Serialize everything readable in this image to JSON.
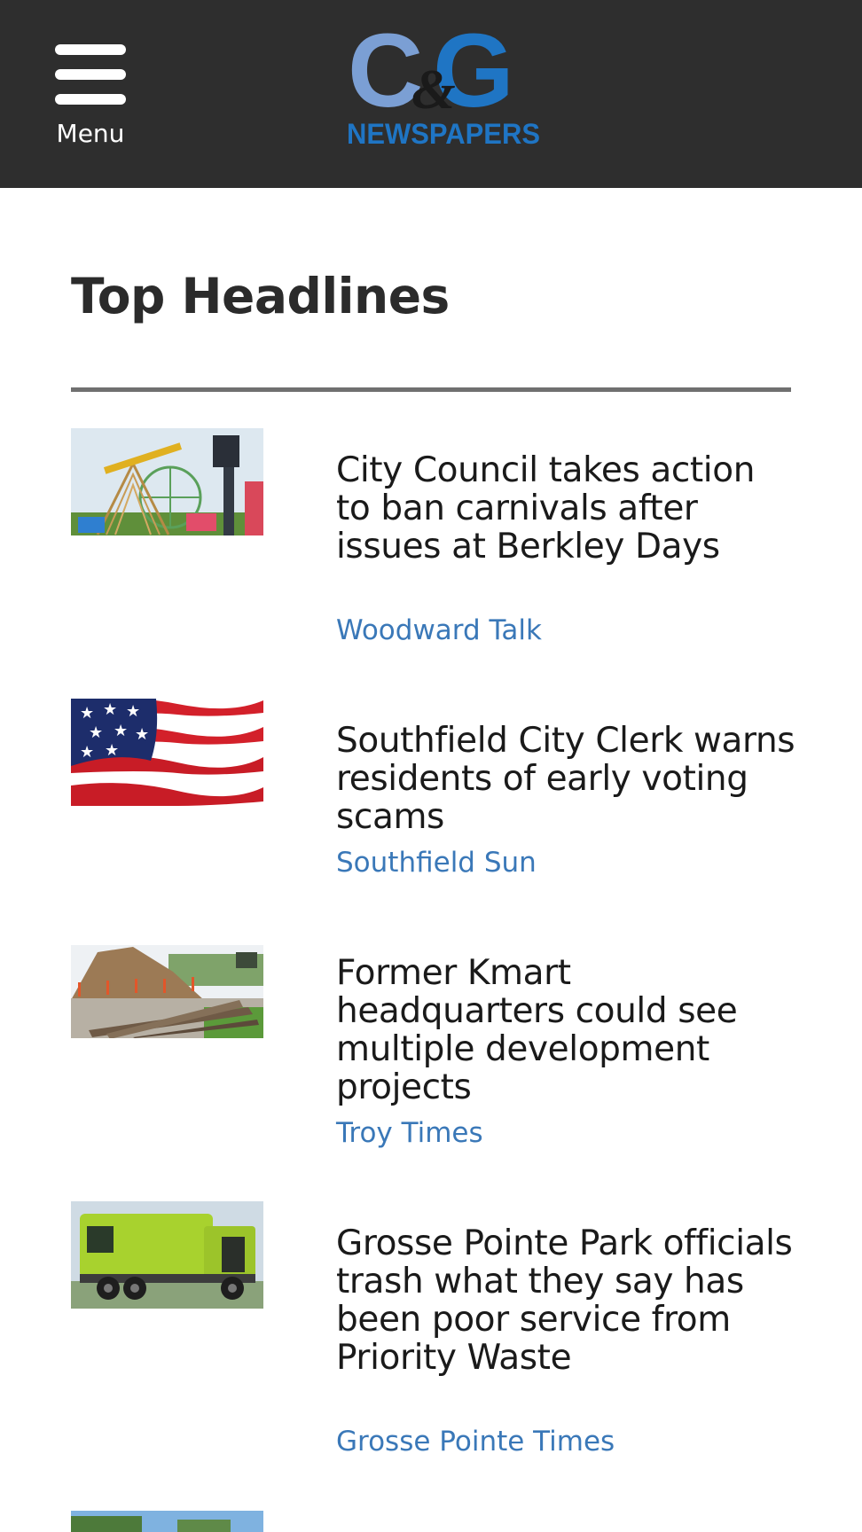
{
  "header": {
    "menu_label": "Menu",
    "logo": {
      "monogram_c": "C",
      "monogram_amp": "&",
      "monogram_g": "G",
      "wordmark": "NEWSPAPERS",
      "colors": {
        "light_blue": "#7b9fd4",
        "blue": "#1f75c4",
        "dark": "#1a1a1a"
      }
    },
    "background": "#2e2e2e"
  },
  "main": {
    "section_title": "Top Headlines",
    "articles": [
      {
        "headline": "City Council takes action to ban carnivals after issues at Berkley Days",
        "source": "Woodward Talk",
        "image": "carnival-rides-photo"
      },
      {
        "headline": "Southfield City Clerk warns residents of early voting scams",
        "source": "Southfield Sun",
        "image": "american-flag-photo"
      },
      {
        "headline": "Former Kmart headquarters could see multiple development projects",
        "source": "Troy Times",
        "image": "construction-dirt-pile-photo"
      },
      {
        "headline": "Grosse Pointe Park officials trash what they say has been poor service from Priority Waste",
        "source": "Grosse Pointe Times",
        "image": "garbage-truck-photo"
      }
    ],
    "colors": {
      "source_link": "#3a78b8",
      "divider": "#707070"
    }
  }
}
